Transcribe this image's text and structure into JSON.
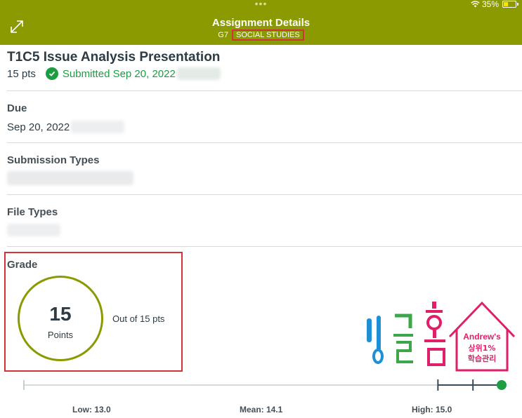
{
  "status_bar": {
    "dots": "•••",
    "battery": "35%",
    "battery_level": 0.35
  },
  "header": {
    "title": "Assignment Details",
    "course_code": "G7",
    "subject": "SOCIAL STUDIES"
  },
  "assignment": {
    "title": "T1C5 Issue Analysis Presentation",
    "points": "15 pts",
    "submitted_text": "Submitted Sep 20, 2022"
  },
  "due": {
    "label": "Due",
    "value": "Sep 20, 2022"
  },
  "submission_types": {
    "label": "Submission Types"
  },
  "file_types": {
    "label": "File Types"
  },
  "grade": {
    "label": "Grade",
    "score": "15",
    "unit": "Points",
    "out_of": "Out of 15 pts"
  },
  "stats": {
    "low": "Low: 13.0",
    "mean": "Mean: 14.1",
    "high": "High: 15.0",
    "low_value": 13.0,
    "mean_value": 14.1,
    "high_value": 15.0,
    "score_value": 15
  },
  "watermark": {
    "korean": "잉글홈",
    "brand": "Andrew's",
    "line2": "상위1%",
    "line3": "학습관리"
  },
  "colors": {
    "header": "#8a9a00",
    "success": "#1c9d42",
    "highlight_border": "#d0343a"
  }
}
